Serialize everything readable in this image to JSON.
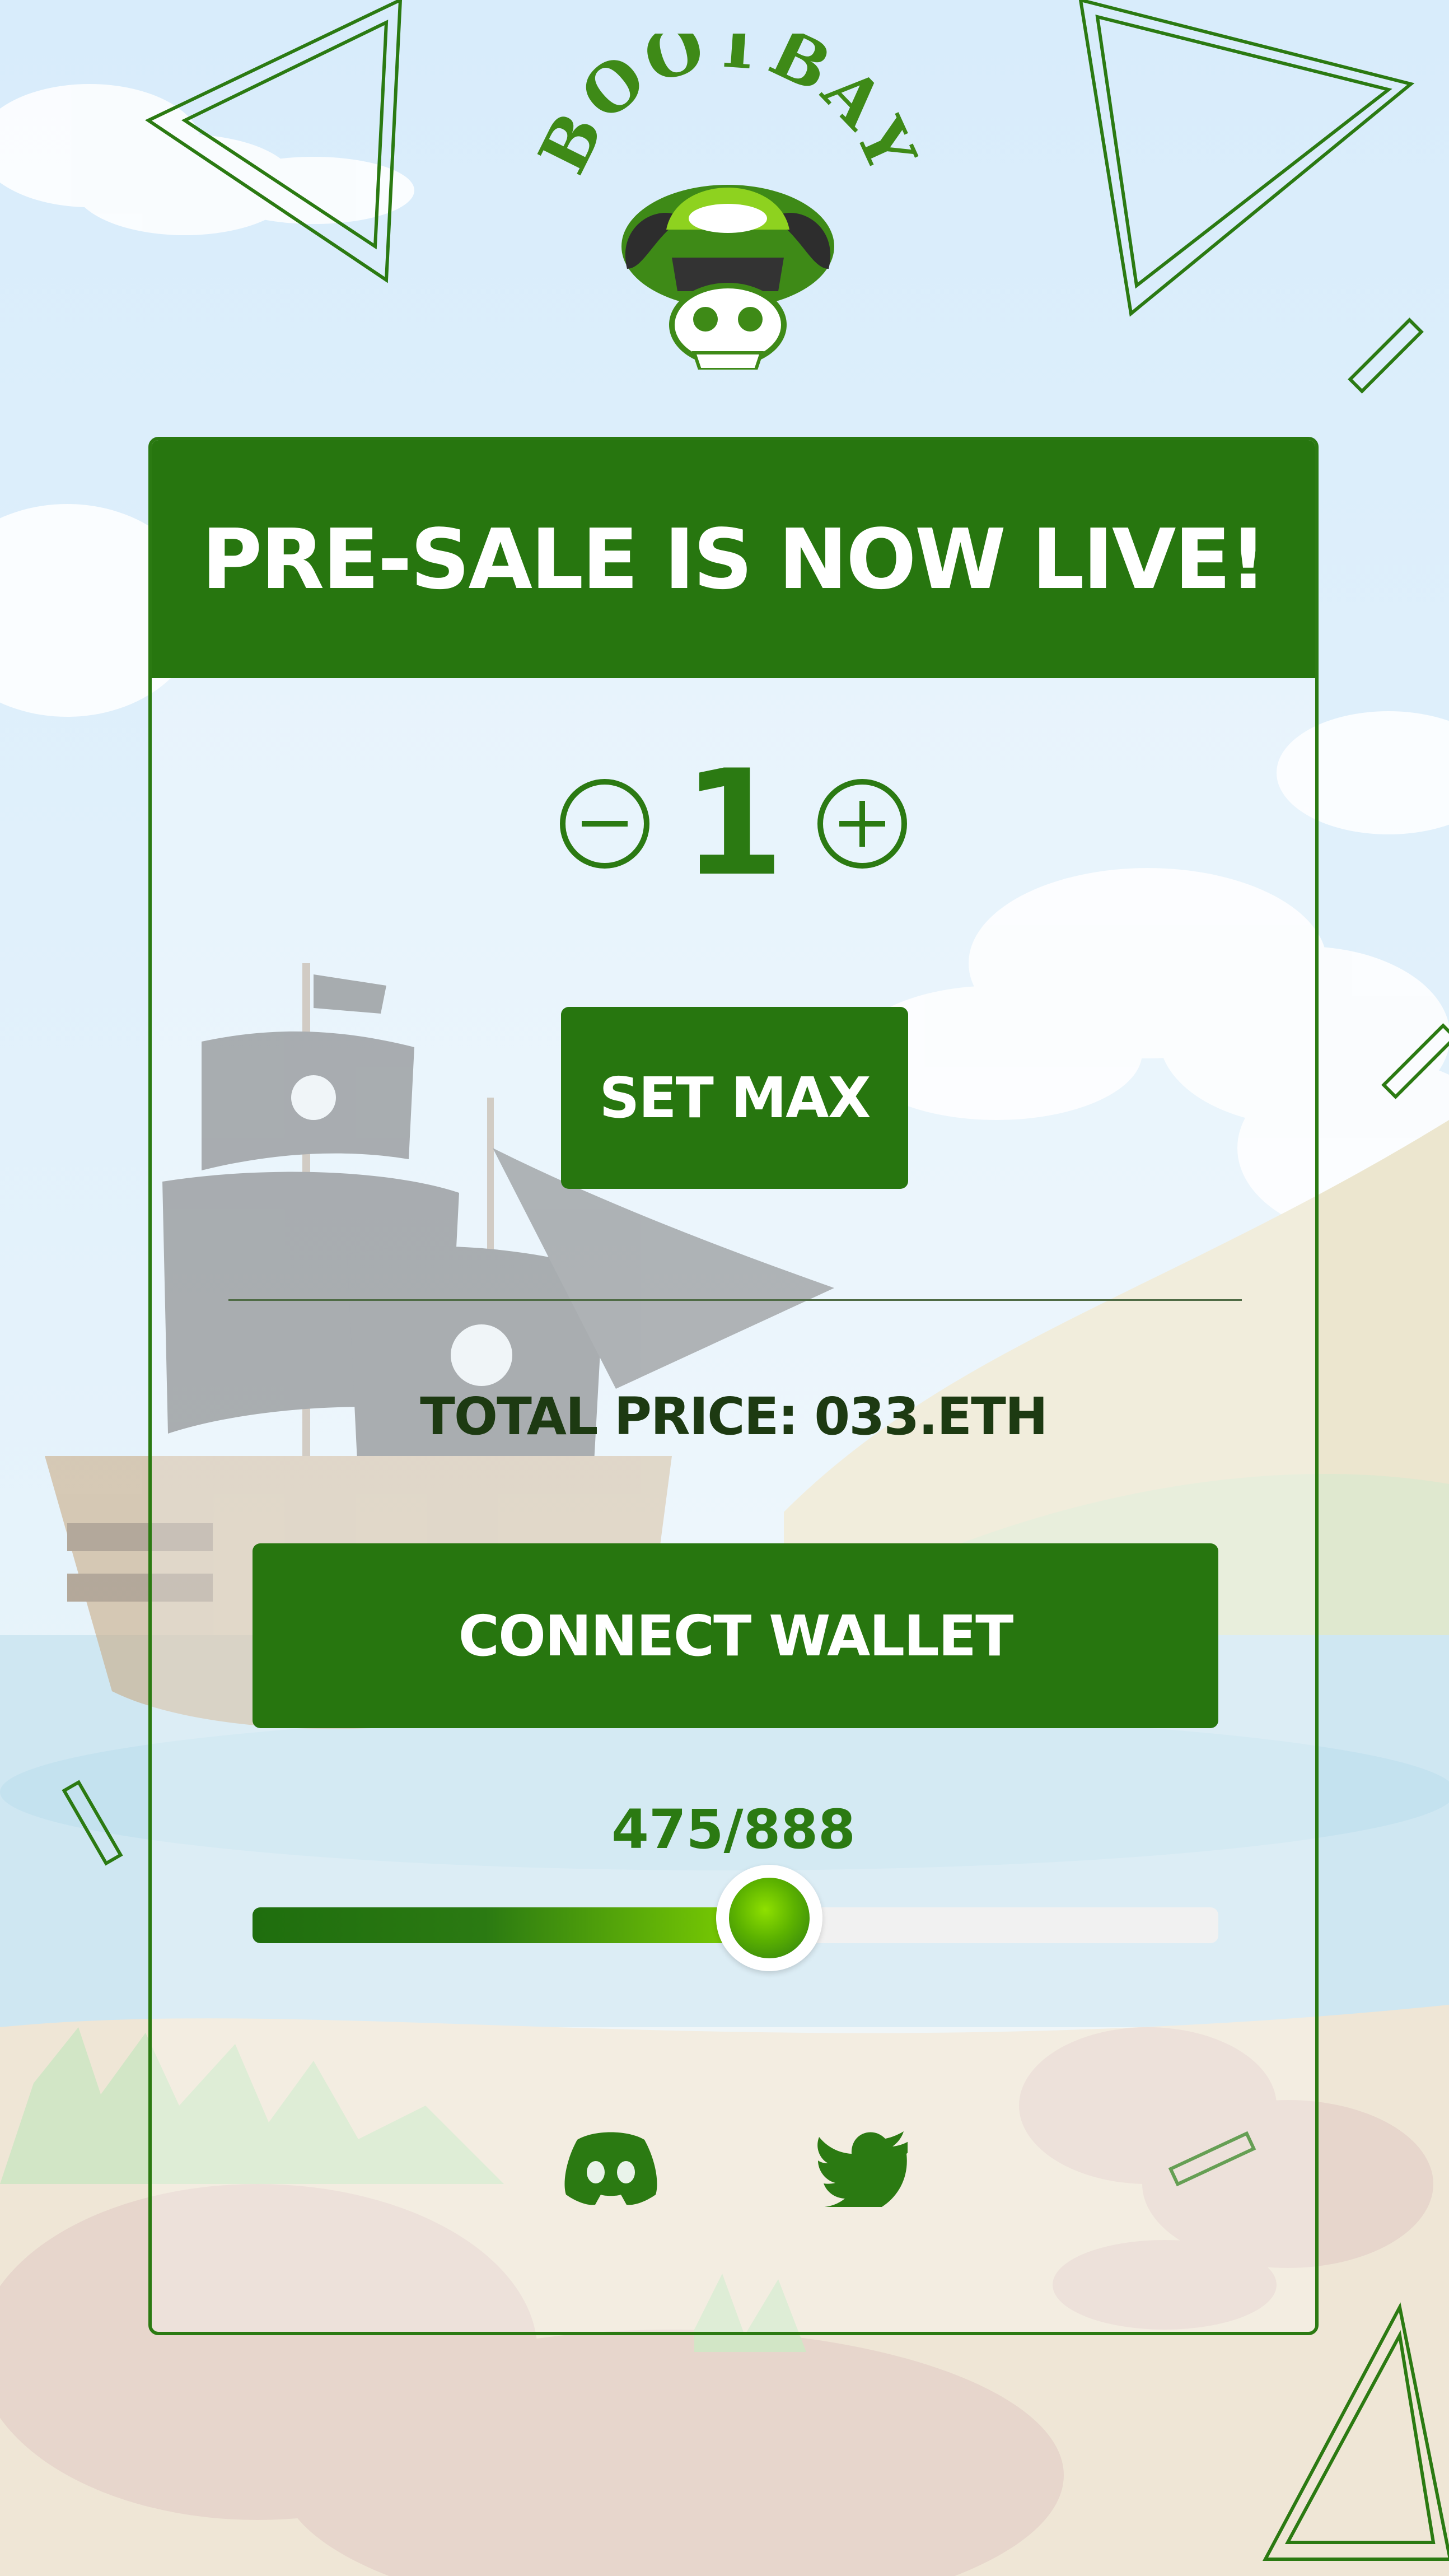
{
  "brand": {
    "name": "BOOTBAY"
  },
  "presale": {
    "headline": "PRE-SALE IS NOW LIVE!",
    "quantity": "1",
    "set_max_label": "SET MAX",
    "total_price": "TOTAL PRICE: 033.ETH",
    "connect_label": "CONNECT WALLET",
    "minted_text": "475/888",
    "minted_fraction": 0.535
  },
  "social": [
    "discord-icon",
    "twitter-icon"
  ],
  "colors": {
    "primary": "#27760f",
    "accent": "#84d600",
    "text_dark": "#1d3a12"
  }
}
